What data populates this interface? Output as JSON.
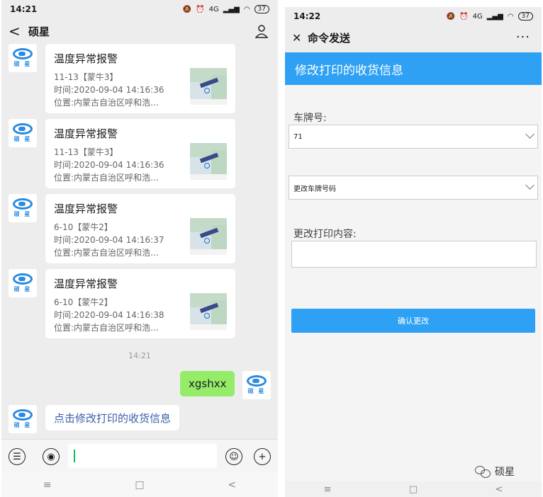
{
  "left": {
    "status": {
      "time": "14:21",
      "battery": "37",
      "signal": "4G"
    },
    "header": {
      "back": "<",
      "title": "硕星"
    },
    "avatar_text": "硕 星",
    "messages": [
      {
        "title": "温度异常报警",
        "line1": "11-13【蒙牛3】",
        "line2": "时间:2020-09-04 14:16:36",
        "line3": "位置:内蒙古自治区呼和浩…"
      },
      {
        "title": "温度异常报警",
        "line1": "11-13【蒙牛3】",
        "line2": "时间:2020-09-04 14:16:36",
        "line3": "位置:内蒙古自治区呼和浩…"
      },
      {
        "title": "温度异常报警",
        "line1": "6-10【蒙牛2】",
        "line2": "时间:2020-09-04 14:16:37",
        "line3": "位置:内蒙古自治区呼和浩…"
      },
      {
        "title": "温度异常报警",
        "line1": "6-10【蒙牛2】",
        "line2": "时间:2020-09-04 14:16:38",
        "line3": "位置:内蒙古自治区呼和浩…"
      }
    ],
    "timestamp": "14:21",
    "sent_text": "xgshxx",
    "reply_text": "点击修改打印的收货信息",
    "nav": {
      "menu": "≡",
      "home": "□",
      "back": "<"
    }
  },
  "right": {
    "status": {
      "time": "14:22",
      "battery": "37",
      "signal": "4G"
    },
    "header": {
      "close": "✕",
      "title": "命令发送",
      "more": "···"
    },
    "banner": "修改打印的收货信息",
    "plate_label": "车牌号:",
    "plate_value": "71",
    "action_value": "更改车牌号码",
    "content_label": "更改打印内容:",
    "confirm_label": "确认更改",
    "nav": {
      "menu": "≡",
      "home": "□",
      "back": "<"
    }
  },
  "watermark": "硕星"
}
